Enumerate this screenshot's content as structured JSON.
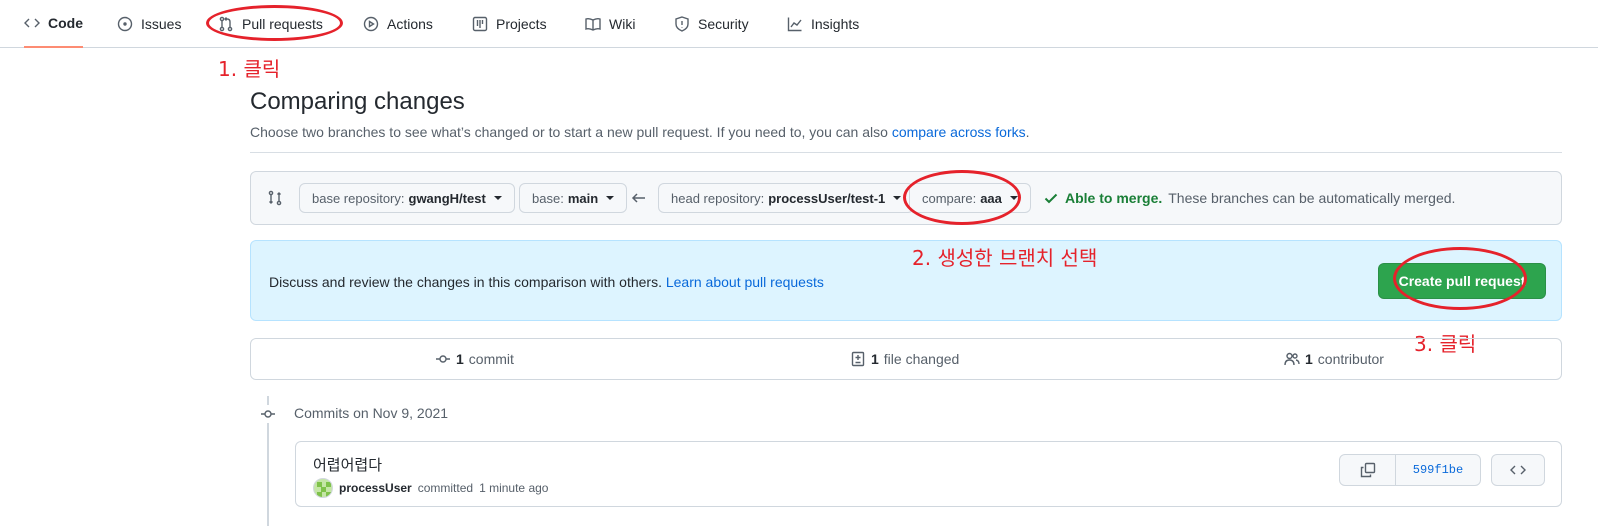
{
  "nav": {
    "tabs": [
      {
        "label": "Code",
        "icon": "code-icon",
        "active": true
      },
      {
        "label": "Issues",
        "icon": "issue-opened-icon"
      },
      {
        "label": "Pull requests",
        "icon": "git-pull-request-icon"
      },
      {
        "label": "Actions",
        "icon": "play-icon"
      },
      {
        "label": "Projects",
        "icon": "table-icon"
      },
      {
        "label": "Wiki",
        "icon": "book-icon"
      },
      {
        "label": "Security",
        "icon": "shield-icon"
      },
      {
        "label": "Insights",
        "icon": "graph-icon"
      }
    ]
  },
  "annotations": {
    "step1": "1. 클릭",
    "step2": "2. 생성한 브랜치 선택",
    "step3": "3. 클릭",
    "color": "#e5222b"
  },
  "compare": {
    "title": "Comparing changes",
    "description": "Choose two branches to see what’s changed or to start a new pull request. If you need to, you can also ",
    "forks_link": "compare across forks",
    "description_end": ".",
    "base_repo_label": "base repository:",
    "base_repo_value": "gwangH/test",
    "base_label": "base:",
    "base_value": "main",
    "head_repo_label": "head repository:",
    "head_repo_value": "processUser/test-1",
    "compare_label": "compare:",
    "compare_value": "aaa",
    "merge_status": "Able to merge.",
    "merge_text": "These branches can be automatically merged."
  },
  "flash": {
    "text": "Discuss and review the changes in this comparison with others. ",
    "link": "Learn about pull requests",
    "button": "Create pull request"
  },
  "summary": {
    "commits_count": "1",
    "commits_label": "commit",
    "files_count": "1",
    "files_label": "file changed",
    "contributors_count": "1",
    "contributors_label": "contributor"
  },
  "commits": {
    "date_heading": "Commits on Nov 9, 2021",
    "items": [
      {
        "message": "어렵어렵다",
        "author": "processUser",
        "action": "committed",
        "time": "1 minute ago",
        "sha": "599f1be"
      }
    ]
  },
  "colors": {
    "accent_blue": "#0969da",
    "success_green": "#2da44e",
    "merge_green": "#1a7f37",
    "active_tab_underline": "#fd8c73"
  }
}
